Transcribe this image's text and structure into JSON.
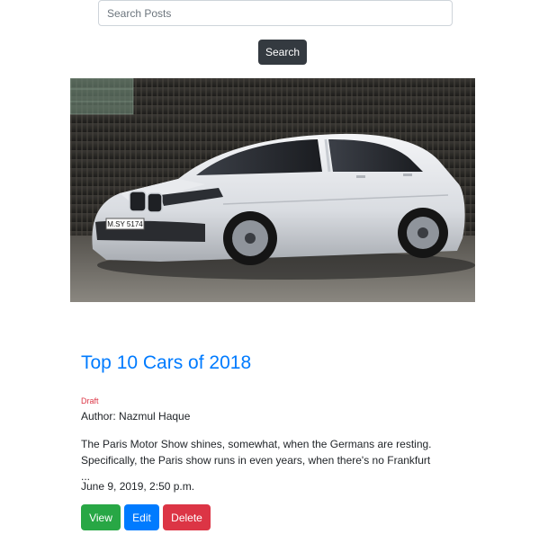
{
  "search": {
    "placeholder": "Search Posts",
    "button_label": "Search"
  },
  "post": {
    "image_plate": "M.SY 5174",
    "title": "Top 10 Cars of 2018",
    "status": "Draft",
    "author": "Author: Nazmul Haque",
    "excerpt": "The Paris Motor Show shines, somewhat, when the Germans are resting. Specifically, the Paris show runs in even years, when there's no Frankfurt ...",
    "date": "June 9, 2019, 2:50 p.m.",
    "actions": {
      "view": "View",
      "edit": "Edit",
      "delete": "Delete"
    }
  },
  "colors": {
    "link": "#007bff",
    "draft": "#dc3545",
    "view": "#28a745",
    "edit": "#007bff",
    "delete": "#dc3545",
    "search_button": "#343a40"
  }
}
